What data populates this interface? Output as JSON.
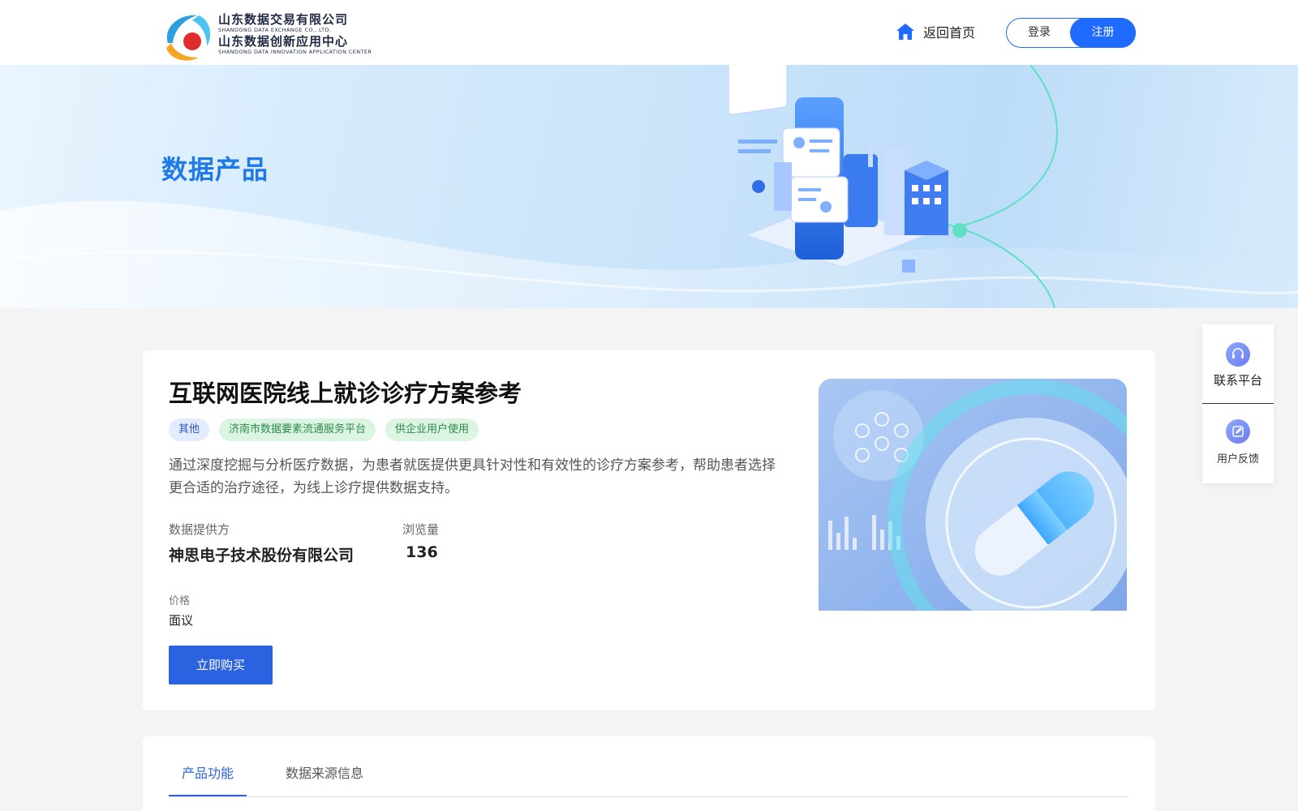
{
  "header": {
    "logo_cn_1": "山东数据交易有限公司",
    "logo_en_1": "SHANDONG DATA EXCHANGE CO., LTD.",
    "logo_cn_2": "山东数据创新应用中心",
    "logo_en_2": "SHANDONG DATA INNOVATION APPLICATION CENTER",
    "home_label": "返回首页",
    "login_label": "登录",
    "register_label": "注册"
  },
  "banner": {
    "title": "数据产品"
  },
  "product": {
    "title": "互联网医院线上就诊诊疗方案参考",
    "tags": [
      "其他",
      "济南市数据要素流通服务平台",
      "供企业用户使用"
    ],
    "description": "通过深度挖掘与分析医疗数据，为患者就医提供更具针对性和有效性的诊疗方案参考，帮助患者选择更合适的治疗途径，为线上诊疗提供数据支持。",
    "provider_label": "数据提供方",
    "provider_value": "神思电子技术股份有限公司",
    "views_label": "浏览量",
    "views_value": "136",
    "price_label": "价格",
    "price_value": "面议",
    "buy_label": "立即购买"
  },
  "tabs": [
    {
      "label": "产品功能",
      "active": true
    },
    {
      "label": "数据来源信息",
      "active": false
    }
  ],
  "side_panel": {
    "contact_label": "联系平台",
    "feedback_label": "用户反馈"
  },
  "colors": {
    "primary": "#1f6bff",
    "accent_blue": "#2a62e0",
    "title_blue": "#1f7ae8"
  }
}
